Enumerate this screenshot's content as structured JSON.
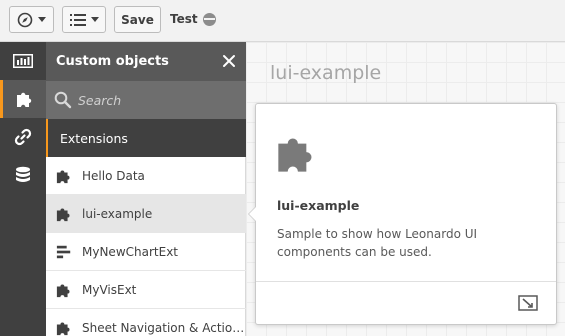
{
  "toolbar": {
    "save_label": "Save",
    "app_title": "Test"
  },
  "rail": {
    "items": [
      {
        "name": "charts",
        "icon": "bar-chart-icon"
      },
      {
        "name": "custom-objects",
        "icon": "puzzle-icon",
        "active": true
      },
      {
        "name": "master-items",
        "icon": "link-icon"
      },
      {
        "name": "fields",
        "icon": "database-icon"
      }
    ]
  },
  "panel": {
    "title": "Custom objects",
    "search_placeholder": "Search",
    "section_label": "Extensions",
    "items": [
      {
        "label": "Hello Data",
        "icon": "puzzle-icon"
      },
      {
        "label": "lui-example",
        "icon": "puzzle-icon",
        "selected": true
      },
      {
        "label": "MyNewChartExt",
        "icon": "bar-chart-icon"
      },
      {
        "label": "MyVisExt",
        "icon": "puzzle-icon"
      },
      {
        "label": "Sheet Navigation & Actio…",
        "icon": "puzzle-icon"
      }
    ]
  },
  "sheet": {
    "title": "lui-example"
  },
  "preview": {
    "title": "lui-example",
    "description": "Sample to show how Leonardo UI components can be used."
  },
  "colors": {
    "accent": "#f8981d",
    "rail": "#404040",
    "panel_header": "#595959"
  }
}
